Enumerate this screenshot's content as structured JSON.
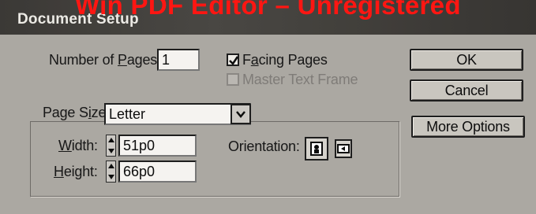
{
  "window": {
    "title": "Document Setup",
    "watermark": "Win PDF Editor – Unregistered"
  },
  "pages": {
    "number_label_prefix": "Number of ",
    "number_label_mnemonic": "P",
    "number_label_suffix": "ages:",
    "number_value": "1"
  },
  "options": {
    "facing_pages_mnemonic": "a",
    "facing_pages_prefix": "F",
    "facing_pages_suffix": "cing Pages",
    "facing_pages_checked": true,
    "master_text_frame": "Master Text Frame",
    "master_text_frame_enabled": false
  },
  "size": {
    "page_size_label_prefix": "Page S",
    "page_size_label_mnemonic": "i",
    "page_size_label_suffix": "ze:",
    "page_size_value": "Letter",
    "width_label_mnemonic": "W",
    "width_label_suffix": "idth:",
    "width_value": "51p0",
    "height_label_mnemonic": "H",
    "height_label_suffix": "eight:",
    "height_value": "66p0",
    "orientation_label": "Orientation:"
  },
  "buttons": {
    "ok": "OK",
    "cancel": "Cancel",
    "more_options": "More Options"
  },
  "icons": {
    "dropdown": "chevron-down-icon",
    "spin": "spin-arrows-icon",
    "portrait": "portrait-orientation-icon",
    "landscape": "landscape-orientation-icon",
    "check": "checkmark-icon"
  },
  "colors": {
    "watermark": "#ff1a16",
    "titlebar": "#3e3c39",
    "dialog_bg": "#a9a6a1"
  }
}
